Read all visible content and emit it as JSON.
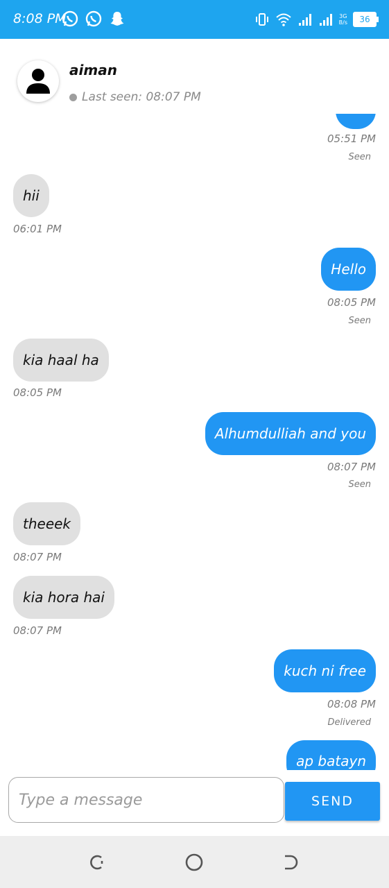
{
  "status_bar": {
    "time": "8:08 PM",
    "battery": "36",
    "network_top": "3G",
    "network_bottom": "B/s",
    "icons": [
      "whatsapp-icon",
      "whatsapp-icon",
      "snapchat-icon",
      "vibrate-icon",
      "wifi-icon",
      "signal-icon",
      "signal-icon",
      "battery-icon"
    ],
    "color": "#1ea5ef"
  },
  "header": {
    "name": "aiman",
    "last_seen": "Last seen: 08:07 PM"
  },
  "messages": [
    {
      "direction": "out",
      "text": "",
      "time": "05:51 PM",
      "status": "Seen"
    },
    {
      "direction": "in",
      "text": "hii",
      "time": "06:01 PM"
    },
    {
      "direction": "out",
      "text": "Hello",
      "time": "08:05 PM",
      "status": "Seen"
    },
    {
      "direction": "in",
      "text": "kia haal ha",
      "time": "08:05 PM"
    },
    {
      "direction": "out",
      "text": "Alhumdulliah and you",
      "time": "08:07 PM",
      "status": "Seen"
    },
    {
      "direction": "in",
      "text": "theeek",
      "time": "08:07 PM"
    },
    {
      "direction": "in",
      "text": "kia hora hai",
      "time": "08:07 PM"
    },
    {
      "direction": "out",
      "text": "kuch ni free",
      "time": "08:08 PM",
      "status": "Delivered"
    },
    {
      "direction": "out",
      "text": "ap batayn",
      "time": "",
      "status": ""
    }
  ],
  "composer": {
    "placeholder": "Type a message",
    "value": "",
    "send_label": "SEND"
  },
  "colors": {
    "outgoing": "#2196f3",
    "incoming": "#e0e0e0"
  }
}
